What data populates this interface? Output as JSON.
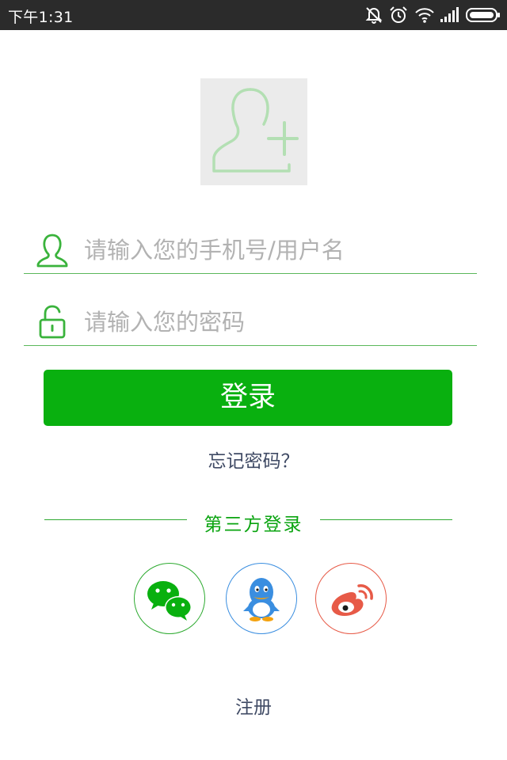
{
  "status_bar": {
    "time": "下午1:31",
    "icons": [
      "mute-vibrate-icon",
      "alarm-icon",
      "wifi-icon",
      "signal-icon",
      "battery-icon"
    ]
  },
  "avatar": {
    "icon": "add-user-icon"
  },
  "username_field": {
    "placeholder": "请输入您的手机号/用户名",
    "value": "",
    "icon": "user-icon"
  },
  "password_field": {
    "placeholder": "请输入您的密码",
    "value": "",
    "icon": "lock-icon"
  },
  "login_button": {
    "label": "登录"
  },
  "forgot_link": {
    "label": "忘记密码？"
  },
  "third_party": {
    "title": "第三方登录",
    "providers": [
      {
        "id": "wechat",
        "icon": "wechat-icon",
        "color": "#09b00f"
      },
      {
        "id": "qq",
        "icon": "qq-icon",
        "color": "#3a8ee0"
      },
      {
        "id": "weibo",
        "icon": "weibo-icon",
        "color": "#e75a47"
      }
    ]
  },
  "register_link": {
    "label": "注册"
  },
  "colors": {
    "accent": "#09b00f",
    "status_bar_bg": "#2b2b2b",
    "placeholder": "#b2b2b2",
    "link_text": "#3f4a64"
  }
}
